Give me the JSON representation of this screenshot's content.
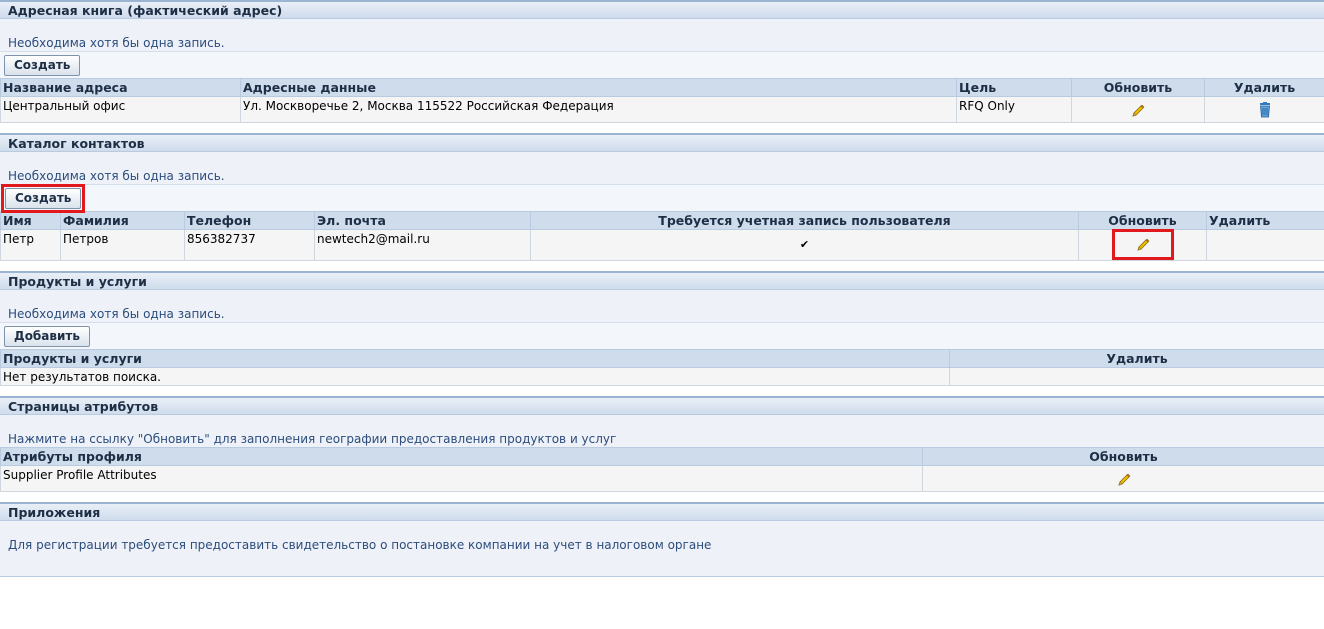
{
  "address_book": {
    "title": "Адресная книга (фактический адрес)",
    "info": "Необходима хотя бы одна запись.",
    "create_label": "Создать",
    "columns": [
      "Название адреса",
      "Адресные данные",
      "Цель",
      "Обновить",
      "Удалить"
    ],
    "rows": [
      {
        "name": "Центральный офис",
        "details": "Ул. Москворечье 2, Москва 115522 Российская Федерация",
        "purpose": "RFQ Only"
      }
    ]
  },
  "contacts": {
    "title": "Каталог контактов",
    "info": "Необходима хотя бы одна запись.",
    "create_label": "Создать",
    "columns": [
      "Имя",
      "Фамилия",
      "Телефон",
      "Эл. почта",
      "Требуется учетная запись пользователя",
      "Обновить",
      "Удалить"
    ],
    "rows": [
      {
        "first_name": "Петр",
        "last_name": "Петров",
        "phone": "856382737",
        "email": "newtech2@mail.ru",
        "account_required": "✔"
      }
    ]
  },
  "products": {
    "title": "Продукты и услуги",
    "info": "Необходима хотя бы одна запись.",
    "add_label": "Добавить",
    "columns": [
      "Продукты и услуги",
      "Удалить"
    ],
    "empty": "Нет результатов поиска."
  },
  "attributes": {
    "title": "Страницы атрибутов",
    "info": "Нажмите на ссылку \"Обновить\" для заполнения географии предоставления продуктов и услуг",
    "columns": [
      "Атрибуты профиля",
      "Обновить"
    ],
    "rows": [
      {
        "name": "Supplier Profile Attributes"
      }
    ]
  },
  "attachments": {
    "title": "Приложения",
    "info": "Для регистрации требуется предоставить свидетельство о постановке компании на учет в налоговом органе"
  },
  "colors": {
    "header_bg": "#cfdcec",
    "info_text": "#2c4c7c",
    "highlight": "#e2191c",
    "pencil": "#f2c200",
    "trash": "#2f7bbf"
  }
}
